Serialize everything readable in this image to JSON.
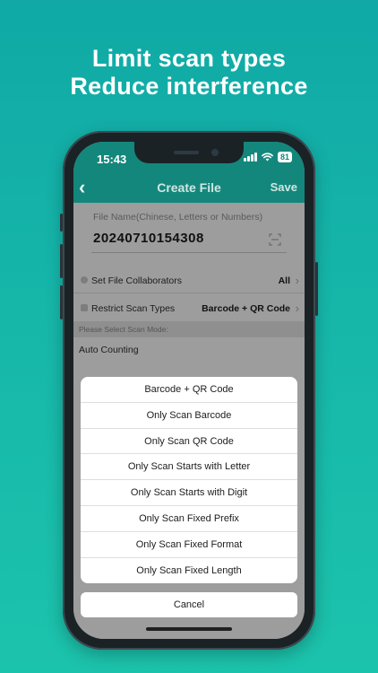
{
  "promo": {
    "line1": "Limit scan types",
    "line2": "Reduce interference"
  },
  "status_bar": {
    "time": "15:43",
    "battery": "81"
  },
  "nav": {
    "back_icon": "chevron-left-icon",
    "title": "Create File",
    "save_label": "Save"
  },
  "form": {
    "file_name_label": "File Name(Chinese, Letters or Numbers)",
    "file_name_value": "20240710154308",
    "collaborators_label": "Set File Collaborators",
    "collaborators_value": "All",
    "restrict_label": "Restrict Scan Types",
    "restrict_value": "Barcode + QR Code",
    "scan_mode_header": "Please Select Scan Mode:",
    "auto_counting_label": "Auto Counting"
  },
  "action_sheet": {
    "options": [
      "Barcode + QR Code",
      "Only Scan Barcode",
      "Only Scan QR Code",
      "Only Scan Starts with Letter",
      "Only Scan Starts with Digit",
      "Only Scan Fixed Prefix",
      "Only Scan Fixed Format",
      "Only Scan Fixed Length"
    ],
    "cancel_label": "Cancel"
  },
  "colors": {
    "background_top": "#10a9a6",
    "background_bottom": "#1cc3ac",
    "nav_bar": "#14877c",
    "overlay_dim": "#9d9d9d"
  }
}
